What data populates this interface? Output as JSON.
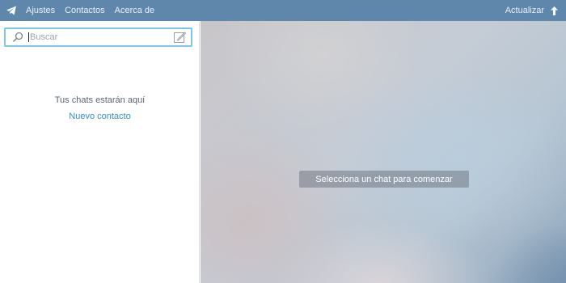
{
  "topbar": {
    "logo_icon": "telegram-plane-icon",
    "menu": [
      "Ajustes",
      "Contactos",
      "Acerca de"
    ],
    "update_label": "Actualizar",
    "update_icon": "arrow-up-icon",
    "background_color": "#5f87ac"
  },
  "sidebar": {
    "search": {
      "placeholder": "Buscar",
      "value": ""
    },
    "compose_icon": "compose-icon",
    "empty_text": "Tus chats estarán aquí",
    "new_contact_link": "Nuevo contacto",
    "accent_color": "#2f8fc6"
  },
  "main": {
    "placeholder_message": "Selecciona un chat para comenzar"
  }
}
